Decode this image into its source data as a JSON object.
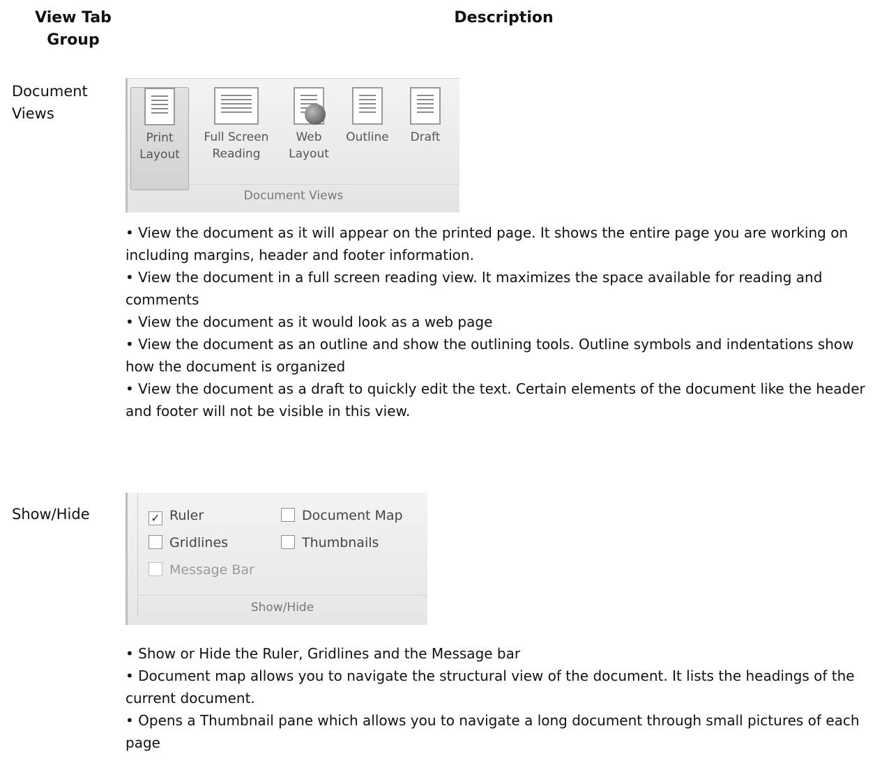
{
  "table_header": {
    "group": "View Tab Group",
    "description": "Description"
  },
  "rows": [
    {
      "group": "Document Views",
      "ribbon": {
        "buttons": [
          "Print Layout",
          "Full Screen Reading",
          "Web Layout",
          "Outline",
          "Draft"
        ],
        "footer": "Document Views"
      },
      "bullets": [
        "• View the document as it will appear on the printed page. It shows the entire page you are working on including margins, header and footer information.",
        "• View the document in a full screen reading view. It maximizes the space available for reading and comments",
        "• View the document as it would look as a web page",
        "• View the document as an outline and show the outlining tools. Outline symbols and indentations show how the document is organized",
        "• View the document as a draft to quickly edit the text. Certain elements of the document like the header and footer will not be visible in this view."
      ]
    },
    {
      "group": "Show/Hide",
      "ribbon": {
        "checkboxes": [
          {
            "label": "Ruler",
            "checked": "✓"
          },
          {
            "label": "Document Map",
            "checked": ""
          },
          {
            "label": "Gridlines",
            "checked": ""
          },
          {
            "label": "Thumbnails",
            "checked": ""
          },
          {
            "label": "Message Bar",
            "checked": ""
          }
        ],
        "footer": "Show/Hide"
      },
      "bullets": [
        "• Show or Hide the Ruler, Gridlines and the Message bar",
        "• Document map allows you to navigate the structural view of the document. It lists the headings of the current document.",
        "• Opens a Thumbnail pane which allows you to navigate a long document through small pictures of each page"
      ]
    }
  ]
}
